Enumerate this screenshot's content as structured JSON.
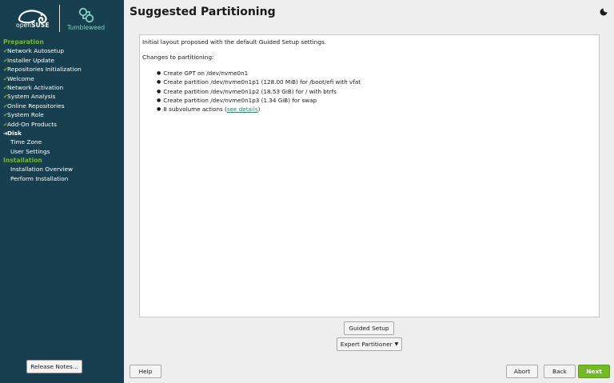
{
  "sidebar": {
    "brand": {
      "open": "open",
      "suse": "SUSE",
      "product": "Tumbleweed"
    },
    "groups": [
      {
        "title": "Preparation",
        "items": [
          {
            "label": "Network Autosetup",
            "state": "done"
          },
          {
            "label": "Installer Update",
            "state": "done"
          },
          {
            "label": "Repositories Initialization",
            "state": "done"
          },
          {
            "label": "Welcome",
            "state": "done"
          },
          {
            "label": "Network Activation",
            "state": "done"
          },
          {
            "label": "System Analysis",
            "state": "done"
          },
          {
            "label": "Online Repositories",
            "state": "done"
          },
          {
            "label": "System Role",
            "state": "done"
          },
          {
            "label": "Add-On Products",
            "state": "done"
          },
          {
            "label": "Disk",
            "state": "current"
          },
          {
            "label": "Time Zone",
            "state": "pending"
          },
          {
            "label": "User Settings",
            "state": "pending"
          }
        ]
      },
      {
        "title": "Installation",
        "items": [
          {
            "label": "Installation Overview",
            "state": "pending"
          },
          {
            "label": "Perform Installation",
            "state": "pending"
          }
        ]
      }
    ],
    "release_notes_label": "Release Notes..."
  },
  "main": {
    "title": "Suggested Partitioning",
    "intro": "Initial layout proposed with the default Guided Setup settings.",
    "changes_label": "Changes to partitioning:",
    "changes": [
      "Create GPT on /dev/nvme0n1",
      "Create partition /dev/nvme0n1p1 (128.00 MiB) for /boot/efi with vfat",
      "Create partition /dev/nvme0n1p2 (18.53 GiB) for / with btrfs",
      "Create partition /dev/nvme0n1p3 (1.34 GiB) for swap"
    ],
    "subvolume_prefix": "8 subvolume actions (",
    "subvolume_link": "see details",
    "subvolume_suffix": ")",
    "guided_setup_label": "Guided Setup",
    "expert_partitioner_label": "Expert Partitioner"
  },
  "footer": {
    "help_label": "Help",
    "abort_label": "Abort",
    "back_label": "Back",
    "next_label": "Next"
  },
  "icons": {
    "done": "check-icon",
    "current": "arrow-right-icon",
    "theme": "moon-icon"
  },
  "colors": {
    "sidebar_bg": "#173f4f",
    "accent_green": "#73ba25",
    "tumbleweed_teal": "#7fd1c0",
    "link": "#2a8a6f"
  }
}
